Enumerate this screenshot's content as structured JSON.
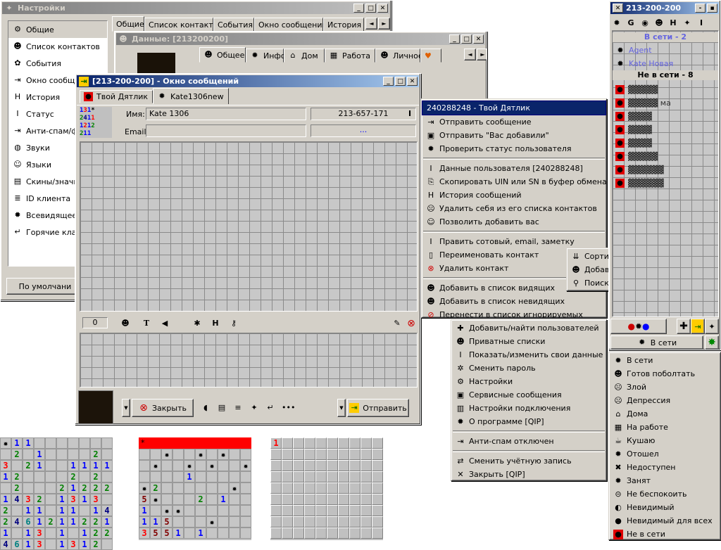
{
  "settings": {
    "title": "Настройки",
    "tabs": [
      "Общие",
      "Список контактов",
      "События",
      "Окно сообщений",
      "История"
    ],
    "items": [
      {
        "label": "Общие",
        "icon": "settings-icon"
      },
      {
        "label": "Список контактов",
        "icon": "contacts-icon"
      },
      {
        "label": "События",
        "icon": "gift-icon"
      },
      {
        "label": "Окно сообще",
        "icon": "message-window-icon"
      },
      {
        "label": "История",
        "icon": "history-icon"
      },
      {
        "label": "Статус",
        "icon": "status-icon"
      },
      {
        "label": "Анти-спам/ф",
        "icon": "antispam-icon"
      },
      {
        "label": "Звуки",
        "icon": "sound-icon"
      },
      {
        "label": "Языки",
        "icon": "language-icon"
      },
      {
        "label": "Скины/значк",
        "icon": "skin-icon"
      },
      {
        "label": "ID клиента",
        "icon": "client-id-icon"
      },
      {
        "label": "Всевидящее с",
        "icon": "eye-icon"
      },
      {
        "label": "Горячие клав",
        "icon": "hotkey-icon"
      }
    ],
    "default_button": "По умолчани"
  },
  "data_window": {
    "title": "Данные: [213200200]",
    "tabs": [
      "Общее",
      "Инфо",
      "Дом",
      "Работа",
      "Личное"
    ]
  },
  "msg": {
    "title": "[213-200-200] - Окно сообщений",
    "tabs": [
      "Твой Дятлик",
      "Kate1306new"
    ],
    "name_label": "Имя:",
    "name_value": "Kate  1306",
    "uin_value": "213-657-171",
    "email_label": "Email:",
    "email_extra": "...",
    "counter": "0",
    "close_label": "Закрыть",
    "send_label": "Отправить"
  },
  "contact_menu": {
    "header": "240288248 - Твой Дятлик",
    "items": [
      {
        "label": "Отправить сообщение",
        "icon": "send-icon"
      },
      {
        "label": "Отправить \"Вас добавили\"",
        "icon": "added-icon"
      },
      {
        "label": "Проверить статус пользователя",
        "icon": "check-status-icon"
      },
      {
        "sep": true
      },
      {
        "label": "Данные пользователя  [240288248]",
        "icon": "user-info-icon"
      },
      {
        "label": "Скопировать UIN или SN в буфер обмена",
        "icon": "copy-icon"
      },
      {
        "label": "История сообщений",
        "icon": "history-icon"
      },
      {
        "label": "Удалить себя из его списка контактов",
        "icon": "remove-self-icon"
      },
      {
        "label": "Позволить добавить вас",
        "icon": "allow-add-icon"
      },
      {
        "sep": true
      },
      {
        "label": "Править сотовый, email, заметку",
        "icon": "edit-icon"
      },
      {
        "label": "Переименовать контакт",
        "icon": "rename-icon"
      },
      {
        "label": "Удалить контакт",
        "icon": "delete-icon"
      },
      {
        "sep": true
      },
      {
        "label": "Добавить в список видящих",
        "icon": "visible-list-icon"
      },
      {
        "label": "Добавить в список невидящих",
        "icon": "invisible-list-icon"
      },
      {
        "label": "Перенести в список игнорируемых",
        "icon": "ignore-icon"
      }
    ]
  },
  "sub_menu": {
    "items": [
      {
        "label": "Сортировать контакты",
        "icon": "sort-icon",
        "arrow": "►"
      },
      {
        "label": "Добавить UIN или SN",
        "icon": "add-uin-icon"
      },
      {
        "label": "Поиск пользователей",
        "icon": "search-icon"
      }
    ]
  },
  "main_menu": {
    "items": [
      {
        "label": "Добавить/найти пользователей",
        "icon": "add-find-icon"
      },
      {
        "label": "Приватные списки",
        "icon": "private-list-icon"
      },
      {
        "label": "Показать/изменить свои данные",
        "icon": "my-data-icon"
      },
      {
        "label": "Сменить пароль",
        "icon": "password-icon"
      },
      {
        "label": "Настройки",
        "icon": "settings-icon"
      },
      {
        "label": "Сервисные сообщения",
        "icon": "service-icon"
      },
      {
        "label": "Настройки подключения",
        "icon": "connection-icon"
      },
      {
        "label": "О программе [QIP]",
        "icon": "about-icon"
      },
      {
        "sep": true
      },
      {
        "label": "Анти-спам отключен",
        "icon": "antispam-icon"
      },
      {
        "sep": true
      },
      {
        "label": "Сменить учётную запись",
        "icon": "account-icon"
      },
      {
        "label": "Закрыть [QIP]",
        "icon": "close-icon"
      }
    ]
  },
  "contact_list": {
    "title": "213-200-200",
    "online_group": "В сети - 2",
    "offline_group": "Не в сети - 8",
    "online_contacts": [
      "Agent",
      "Kate Новая"
    ],
    "offline_contacts": [
      "▓▓▓▓▓",
      "▓▓▓▓▓ ма",
      "▓▓▓▓",
      "▓▓▓▓",
      "▓▓▓▓",
      "▓▓▓▓▓",
      "▓▓▓▓▓▓",
      "▓▓▓▓▓▓"
    ],
    "status_button": "В сети"
  },
  "status_menu": {
    "items": [
      {
        "label": "В сети",
        "icon": "online-icon"
      },
      {
        "label": "Готов поболтать",
        "icon": "chat-icon"
      },
      {
        "label": "Злой",
        "icon": "angry-icon"
      },
      {
        "label": "Депрессия",
        "icon": "depression-icon"
      },
      {
        "label": "Дома",
        "icon": "home-icon"
      },
      {
        "label": "На работе",
        "icon": "work-icon"
      },
      {
        "label": "Кушаю",
        "icon": "eating-icon"
      },
      {
        "label": "Отошел",
        "icon": "away-icon"
      },
      {
        "label": "Недоступен",
        "icon": "na-icon"
      },
      {
        "label": "Занят",
        "icon": "busy-icon"
      },
      {
        "label": "Не беспокоить",
        "icon": "dnd-icon"
      },
      {
        "label": "Невидимый",
        "icon": "invisible-icon"
      },
      {
        "label": "Невидимый для всех",
        "icon": "invisible-all-icon"
      },
      {
        "label": "Не в сети",
        "icon": "offline-icon"
      }
    ]
  },
  "minesweeper": {
    "board1_rows": [
      "*11-------",
      "-2-1----2-",
      "3-21--1111",
      "12----2-2-",
      "-2---21222",
      "1432-1313",
      "2-11-11-14",
      "2461211221",
      "1-13-1-122",
      "4613-1312-"
    ],
    "board2_header": "*",
    "board3_header": "1"
  },
  "colors": {
    "titlebar": "#0a246a",
    "face": "#d4d0c8",
    "red": "#ff0000"
  }
}
